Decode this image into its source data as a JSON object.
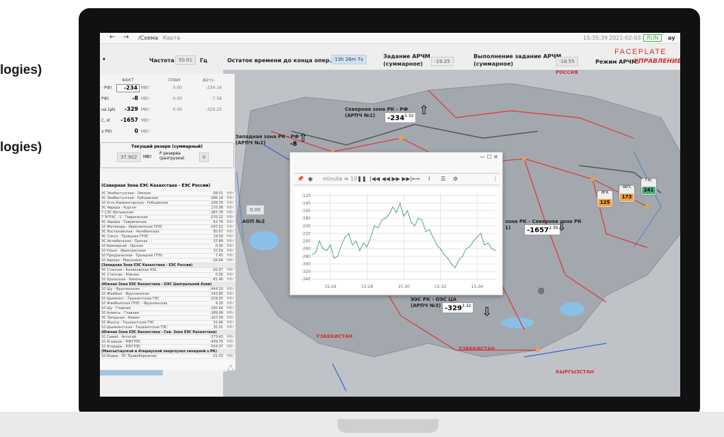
{
  "side_texts": [
    "logies)",
    "logies)"
  ],
  "topbar": {
    "back": "←",
    "forward": "→",
    "path": "/Схема",
    "tab_map": "Карта",
    "time": "15:35:39",
    "date": "2021-02-03",
    "run_label": "RUN",
    "user": "ау"
  },
  "status": {
    "freq_label": "Частота",
    "freq_value": "50.01",
    "freq_unit": "Гц",
    "remain_label": "Остаток времени до конца опер. суток",
    "remain_value": "13h 26m 7s",
    "task_label_1": "Задание АРЧМ",
    "task_label_2": "(суммарное)",
    "task_value": "-19.25",
    "exec_label_1": "Выполнение задание АРЧМ",
    "exec_label_2": "(суммарное)",
    "exec_value": "-18.55",
    "brand": "FACEPLATE",
    "mode_label": "Режим АРЧМ:",
    "mode_value": "УПРАВЛЕНИЕ"
  },
  "left_panel": {
    "col_fact": "ФАКТ",
    "col_plan": "ПЛАН",
    "col_dev": "ΔU+/-",
    "rows": [
      {
        "label": "- РФ)",
        "fact": "-234",
        "unit": "МВт",
        "plan": "0.00",
        "dev": "-234.16"
      },
      {
        "label": "РФ)",
        "fact": "-8",
        "unit": "МВт",
        "plan": "0.00",
        "dev": "-7.58"
      },
      {
        "label": "на ЦА)",
        "fact": "-329",
        "unit": "МВт",
        "plan": "0.00",
        "dev": "-329.20"
      },
      {
        "label": "С, И",
        "fact": "-1657",
        "unit": "МВт",
        "plan": "",
        "dev": ""
      },
      {
        "label": "э РЮ",
        "fact": "0",
        "unit": "МВт",
        "plan": "",
        "dev": ""
      }
    ],
    "reserve_title": "Текущий резерв (суммарный)",
    "reserve_value": "37.902",
    "reserve_unit": "МВт",
    "reserve_sub": "Р резерва (разгрузки)",
    "reserve_value2": "0",
    "list_title": "(Северная Зона ЕЭС Казахстана - ЕЭС России)",
    "list_rows": [
      {
        "name": "ЭС Экибастузская - Омская",
        "value": "-58.51"
      },
      {
        "name": "ЭС Экибастузская - Рубцовская",
        "value": "-186.14"
      },
      {
        "name": "10 Усть-Каменогорская - Рубцовская",
        "value": "209.70"
      },
      {
        "name": "ЭС Аврора - Курган",
        "value": "170.06"
      },
      {
        "name": "7 СЭС Иртышская",
        "value": "-287.78"
      },
      {
        "name": "7 ЭГРЭС - 1 - Таврическая",
        "value": "-270.22"
      },
      {
        "name": "ЭС Аврора - Таврическая",
        "value": "42.76"
      },
      {
        "name": "10 Житикара - Ириклинская ГРЭС",
        "value": "-297.52"
      },
      {
        "name": "ЭС Костанайская - Челябинская",
        "value": "85.67"
      },
      {
        "name": "ЭС Сокол - Троицкая ГРЭС",
        "value": "19.59"
      },
      {
        "name": "ЭС Актюбинская - Орская",
        "value": "37.89"
      },
      {
        "name": "10 Кимперсай - Орская",
        "value": "0.00"
      },
      {
        "name": "10 Ульке - Ирикгресская",
        "value": "37.59"
      },
      {
        "name": "10 Приуральская - Троицкая ГРЭС",
        "value": "7.45"
      },
      {
        "name": "10 Аврора - Макушино",
        "value": "-26.84"
      },
      {
        "name": "(Западная Зона ЕЭС Казахстана - ЕЭС России)",
        "value": "",
        "hdr": true
      },
      {
        "name": "ЭС Степная - Балаковская АЭС",
        "value": "-92.67"
      },
      {
        "name": "ЭС Степная - Южная",
        "value": "0.00"
      },
      {
        "name": "10 Уральская - Кинель",
        "value": "-81.46"
      },
      {
        "name": "(Южная Зона ЕЭС Казахстана - ОЭС Центральной Азии)",
        "value": "",
        "hdr": true
      },
      {
        "name": "10 Шу - Фрунзенская",
        "value": "-444.10"
      },
      {
        "name": "10 Жамбыл - Фрунзенская",
        "value": "143.85"
      },
      {
        "name": "10 Шымкент - Ташкентская ТЭС",
        "value": "-229.05"
      },
      {
        "name": "10 Жамбылская ГРЭС - Фрунзенская",
        "value": "4.20"
      },
      {
        "name": "10 Шу - Главная",
        "value": "-195.64"
      },
      {
        "name": "10 Алматы - Главная",
        "value": "-189.99"
      },
      {
        "name": "ЭС Западная - Кемин",
        "value": "-167.59"
      },
      {
        "name": "10 Жылга - Ташкентская ТЭС",
        "value": "31.66"
      },
      {
        "name": "10 Шымкентская - Ташкентская ТЭС",
        "value": "35.01"
      },
      {
        "name": "(Южная Зона ЕЭС Казахстана - Сев. Зона ЕЭС Казахстана)",
        "value": "",
        "hdr": true
      },
      {
        "name": "10 Семей - Актогай",
        "value": "-373.43"
      },
      {
        "name": "10 Агадырь - ЮКГРЭС",
        "value": "-439.74"
      },
      {
        "name": "10 Агадырь - ЮКГРЭС",
        "value": "-534.07"
      },
      {
        "name": "(Мангыстауской и Атырауской энергоузел западной з.РК)",
        "value": "",
        "hdr": true
      },
      {
        "name": "10 Индер - ПС Правобережная",
        "value": "-31.03"
      }
    ]
  },
  "map": {
    "russia": "РОССИЯ",
    "uzbekistan_1": "УЗБЕКИСТАН",
    "uzbekistan_2": "УЗБЕКИСТАН",
    "kyrgyzstan": "КЫРГЫЗСТАН",
    "north_zone_1": "Северная зона РК - РФ",
    "north_zone_2": "(АРПЧ №1)",
    "north_value": "-234",
    "north_sup": "2.32",
    "west_zone_1": "Западная зона РК - РФ",
    "west_zone_2": "(АРПЧ №2)",
    "west_value": "-8",
    "aop_value": "0.00",
    "aop_label": "АОП №2",
    "south_zone_1": "зона РК - Северная зона РК",
    "south_zone_2": "1)",
    "south_value": "-1657",
    "south_sup": "2.30",
    "ca_zone_1": "ЭЭС РК - ОЭС ЦА",
    "ca_zone_2": "(АРПЧ №3)",
    "ca_value": "-329",
    "ca_sup": "3.32",
    "energy": [
      {
        "label": "ВГК",
        "value": "125",
        "color": "#f0a040"
      },
      {
        "label": "ЧКГС",
        "value": "173",
        "color": "#f0a040"
      },
      {
        "label": "ГЭС",
        "value": "241",
        "color": "#4caf80"
      }
    ]
  },
  "popup": {
    "window_controls": "—   ☐   ✕",
    "toolbar": {
      "pin": "📌",
      "mode_icon": "◉",
      "range": "minute ≡ 10",
      "pause": "❚❚",
      "nav": "|◀◀ ◀◀ ▶▶ ▶▶|",
      "fit": "⟷",
      "cursor": "Ⅰ",
      "list": "☰",
      "settings": "⚙",
      "more": "⋮"
    },
    "chart_data": {
      "type": "line",
      "title": "",
      "xlabel": "",
      "ylabel": "",
      "x_ticks": [
        "15:26",
        "15:28",
        "15:30",
        "15:32",
        "15:34"
      ],
      "y_ticks": [
        -120,
        -140,
        -160,
        -180,
        -200,
        -220,
        -240,
        -260,
        -280,
        -300,
        -320,
        -340
      ],
      "ylim": [
        -345,
        -115
      ],
      "color": "#4e9f99",
      "grid": true,
      "series": [
        {
          "x_minutes": [
            0.0,
            0.2,
            0.4,
            0.6,
            0.8,
            1.0,
            1.2,
            1.4,
            1.6,
            1.8,
            2.0,
            2.2,
            2.4,
            2.6,
            2.8,
            3.0,
            3.2,
            3.4,
            3.6,
            3.8,
            4.0,
            4.2,
            4.4,
            4.6,
            4.8,
            5.0,
            5.2,
            5.4,
            5.6,
            5.8,
            6.0,
            6.2,
            6.4,
            6.6,
            6.8,
            7.0,
            7.2,
            7.4,
            7.6,
            7.8,
            8.0,
            8.2,
            8.4,
            8.6,
            8.8,
            9.0,
            9.2,
            9.4,
            9.6,
            9.8,
            10.0
          ],
          "values": [
            -275,
            -270,
            -240,
            -260,
            -265,
            -250,
            -285,
            -280,
            -250,
            -230,
            -220,
            -250,
            -240,
            -265,
            -245,
            -255,
            -230,
            -200,
            -205,
            -185,
            -180,
            -170,
            -150,
            -165,
            -140,
            -175,
            -160,
            -190,
            -200,
            -180,
            -185,
            -215,
            -210,
            -230,
            -250,
            -260,
            -275,
            -285,
            -300,
            -310,
            -290,
            -280,
            -260,
            -255,
            -240,
            -230,
            -220,
            -250,
            -245,
            -260,
            -265
          ]
        }
      ]
    }
  }
}
